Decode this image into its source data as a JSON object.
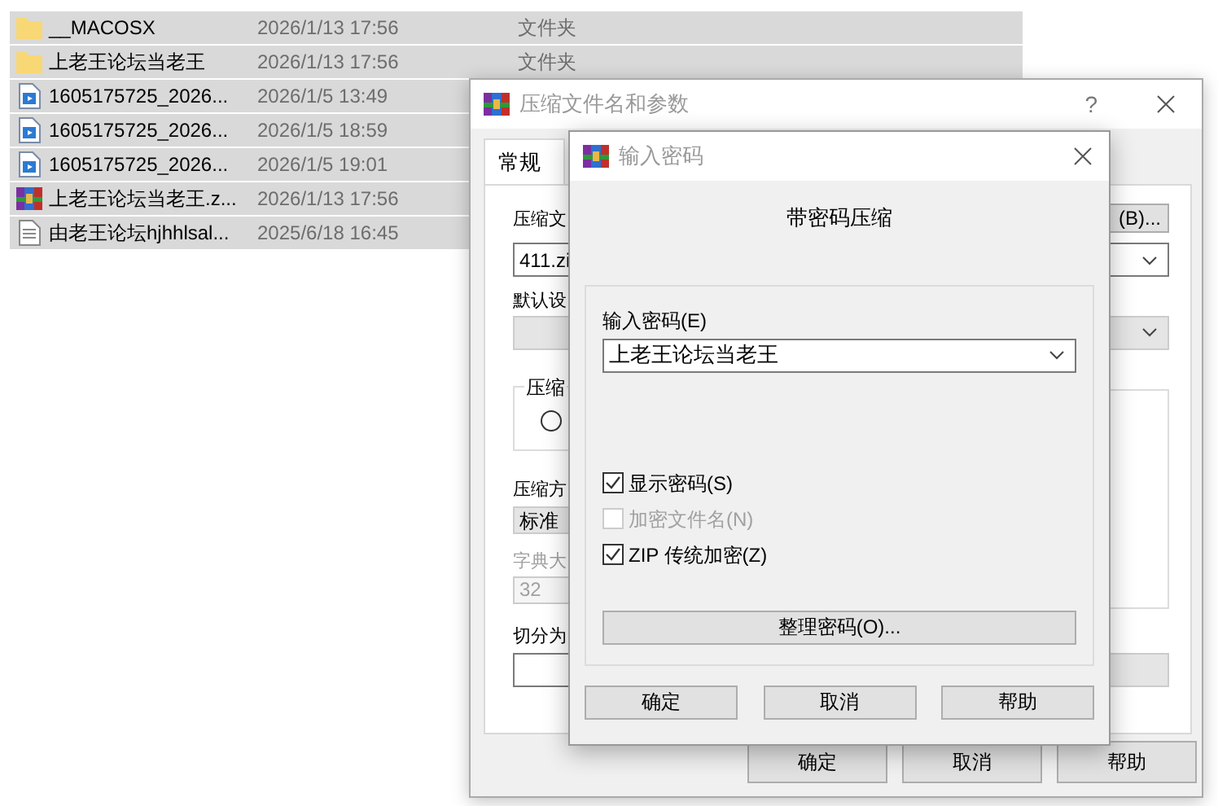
{
  "file_list": {
    "rows": [
      {
        "kind": "folder",
        "name": "__MACOSX",
        "date": "2026/1/13 17:56",
        "type": "文件夹",
        "selected": true
      },
      {
        "kind": "folder",
        "name": "上老王论坛当老王",
        "date": "2026/1/13 17:56",
        "type": "文件夹",
        "selected": true
      },
      {
        "kind": "video",
        "name": "1605175725_2026...",
        "date": "2026/1/5 13:49",
        "selected": true
      },
      {
        "kind": "video",
        "name": "1605175725_2026...",
        "date": "2026/1/5 18:59",
        "selected": true
      },
      {
        "kind": "video",
        "name": "1605175725_2026...",
        "date": "2026/1/5 19:01",
        "selected": true
      },
      {
        "kind": "archive",
        "name": "上老王论坛当老王.z...",
        "date": "2026/1/13 17:56",
        "selected": true
      },
      {
        "kind": "text",
        "name": "由老王论坛hjhhlsal...",
        "date": "2025/6/18 16:45",
        "selected": true
      }
    ]
  },
  "archive_dialog": {
    "title": "压缩文件名和参数",
    "help": "?",
    "tabs": [
      {
        "label": "常规",
        "selected": true
      }
    ],
    "browse_button": "(B)...",
    "archive_name": {
      "label": "压缩文",
      "value": "411.zi"
    },
    "profile": {
      "label": "默认设",
      "disabled": true
    },
    "format_group": {
      "label": "压缩",
      "radio_selected": false
    },
    "method": {
      "label": "压缩方",
      "value": "标准"
    },
    "dictionary": {
      "label": "字典大",
      "value": "32",
      "disabled": true
    },
    "split": {
      "label": "切分为"
    },
    "buttons": [
      "确定",
      "取消",
      "帮助"
    ]
  },
  "password_dialog": {
    "title": "输入密码",
    "heading": "带密码压缩",
    "password": {
      "label": "输入密码(E)",
      "value": "上老王论坛当老王"
    },
    "checkboxes": [
      {
        "label": "显示密码(S)",
        "checked": true,
        "disabled": false
      },
      {
        "label": "加密文件名(N)",
        "checked": false,
        "disabled": true
      },
      {
        "label": "ZIP 传统加密(Z)",
        "checked": true,
        "disabled": false
      }
    ],
    "organize_button": "整理密码(O)...",
    "buttons": [
      "确定",
      "取消",
      "帮助"
    ]
  }
}
